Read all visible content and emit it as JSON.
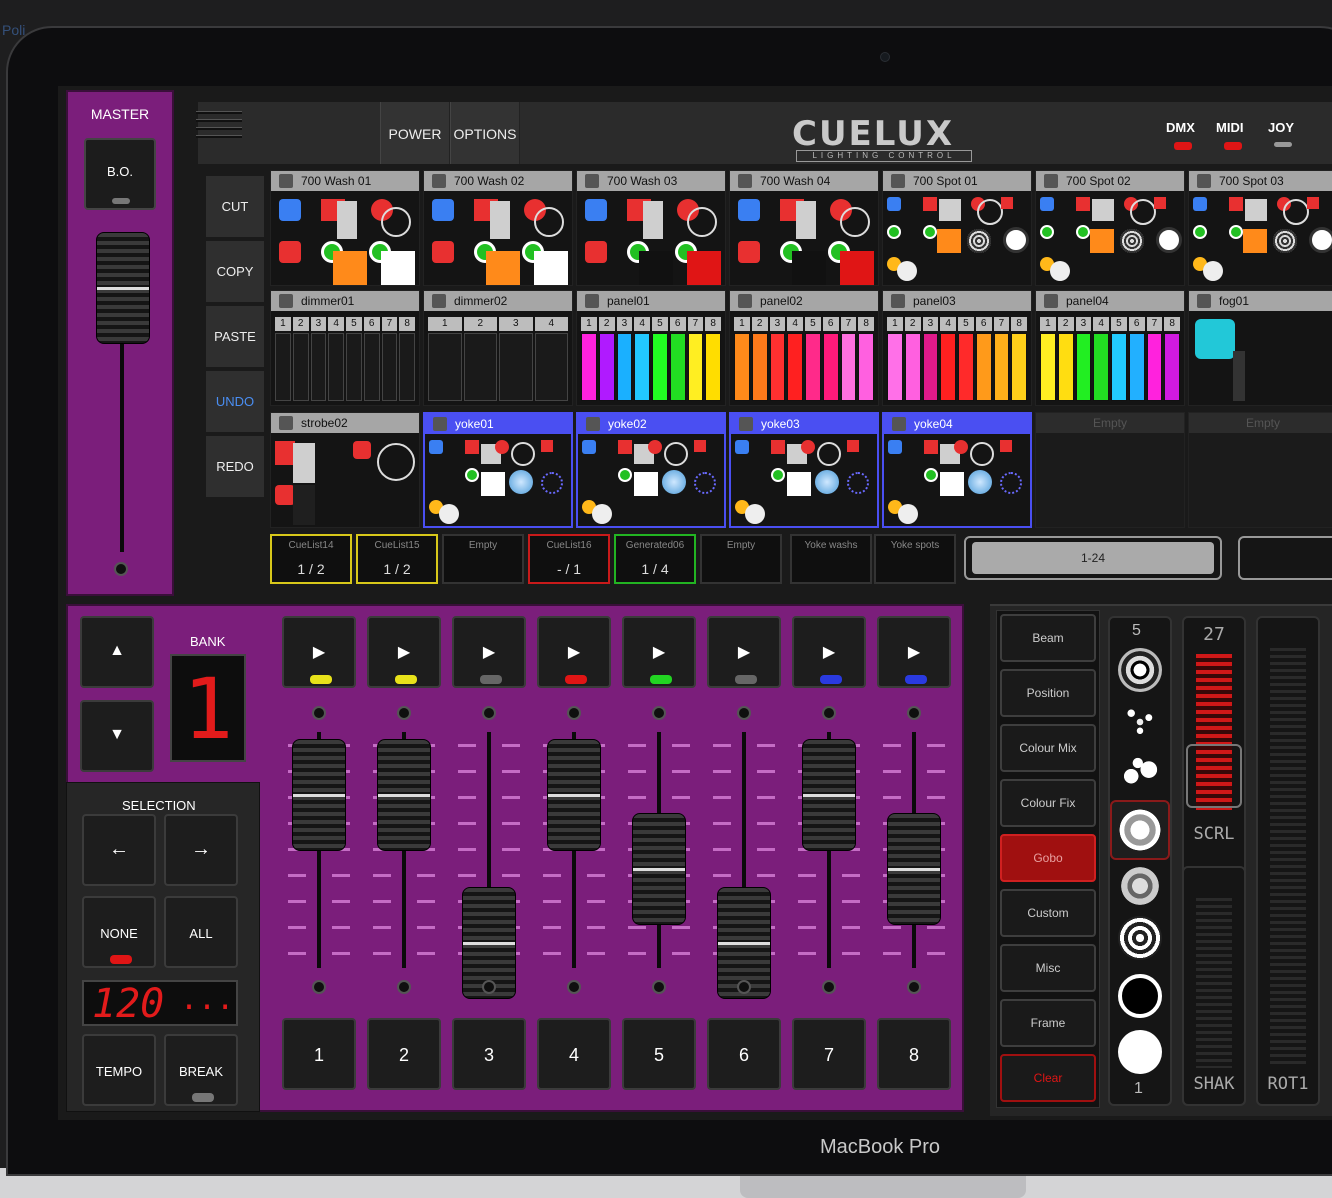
{
  "screen": {
    "title_fragment": "Poli",
    "laptop_label": "MacBook Pro"
  },
  "master": {
    "label": "MASTER",
    "blackout_label": "B.O."
  },
  "topbar": {
    "power_label": "POWER",
    "options_label": "OPTIONS",
    "logo_text": "CUELUX",
    "logo_sub": "LIGHTING CONTROL",
    "indicators": [
      {
        "label": "DMX",
        "color": "#e01515"
      },
      {
        "label": "MIDI",
        "color": "#e01515"
      },
      {
        "label": "JOY",
        "color": "#999999"
      }
    ]
  },
  "edit_buttons": [
    {
      "label": "CUT"
    },
    {
      "label": "COPY"
    },
    {
      "label": "PASTE"
    },
    {
      "label": "UNDO"
    },
    {
      "label": "REDO"
    }
  ],
  "fixtures": {
    "row1": [
      "700 Wash 01",
      "700 Wash 02",
      "700 Wash 03",
      "700 Wash 04",
      "700 Spot 01",
      "700 Spot 02",
      "700 Spot 03"
    ],
    "row2": [
      "dimmer01",
      "dimmer02",
      "panel01",
      "panel02",
      "panel03",
      "panel04",
      "fog01"
    ],
    "row3": [
      "strobe02",
      "yoke01",
      "yoke02",
      "yoke03",
      "yoke04",
      "Empty",
      "Empty"
    ],
    "dimmer01_channels": [
      "1",
      "2",
      "3",
      "4",
      "5",
      "6",
      "7",
      "8"
    ],
    "dimmer02_channels": [
      "1",
      "2",
      "3",
      "4"
    ],
    "panel_channels": [
      "1",
      "2",
      "3",
      "4",
      "5",
      "6",
      "7",
      "8"
    ]
  },
  "cuelists": [
    {
      "name": "CueList14",
      "value": "1 / 2",
      "color": "#d8c81a"
    },
    {
      "name": "CueList15",
      "value": "1 / 2",
      "color": "#d8c81a"
    },
    {
      "name": "Empty",
      "value": "",
      "color": "#333333"
    },
    {
      "name": "CueList16",
      "value": "- / 1",
      "color": "#c81a1a"
    },
    {
      "name": "Generated06",
      "value": "1 / 4",
      "color": "#22b422"
    },
    {
      "name": "Empty",
      "value": "",
      "color": "#333333"
    },
    {
      "name": "Yoke washs",
      "value": "",
      "color": "#333333"
    },
    {
      "name": "Yoke spots",
      "value": "",
      "color": "#333333"
    }
  ],
  "pager": {
    "label": "1-24"
  },
  "bank": {
    "label": "BANK",
    "value": "1",
    "up": "▲",
    "down": "▼"
  },
  "selection": {
    "label": "SELECTION",
    "left": "←",
    "right": "→",
    "none": "NONE",
    "all": "ALL"
  },
  "tempo": {
    "display": "120",
    "dots": "...",
    "tempo_label": "TEMPO",
    "break_label": "BREAK"
  },
  "playbacks": [
    {
      "number": "1",
      "play": "▶",
      "led": "#e8e21a",
      "level": 0.85
    },
    {
      "number": "2",
      "play": "▶",
      "led": "#e8e21a",
      "level": 0.85
    },
    {
      "number": "3",
      "play": "▶",
      "led": "#666666",
      "level": 0.25
    },
    {
      "number": "4",
      "play": "▶",
      "led": "#e01515",
      "level": 0.85
    },
    {
      "number": "5",
      "play": "▶",
      "led": "#22d422",
      "level": 0.55
    },
    {
      "number": "6",
      "play": "▶",
      "led": "#666666",
      "level": 0.25
    },
    {
      "number": "7",
      "play": "▶",
      "led": "#2a3ae0",
      "level": 0.85
    },
    {
      "number": "8",
      "play": "▶",
      "led": "#2a3ae0",
      "level": 0.55
    }
  ],
  "categories": [
    {
      "label": "Beam",
      "active": false
    },
    {
      "label": "Position",
      "active": false
    },
    {
      "label": "Colour Mix",
      "active": false
    },
    {
      "label": "Colour Fix",
      "active": false
    },
    {
      "label": "Gobo",
      "active": true
    },
    {
      "label": "Custom",
      "active": false
    },
    {
      "label": "Misc",
      "active": false
    },
    {
      "label": "Frame",
      "active": false
    },
    {
      "label": "Clear",
      "active": false
    }
  ],
  "gobo": {
    "top": "5",
    "bottom": "1"
  },
  "lanes": [
    {
      "top": "27",
      "label": "SCRL"
    },
    {
      "top": "",
      "label": "SHAK"
    },
    {
      "top": "",
      "label": "ROT1"
    }
  ]
}
